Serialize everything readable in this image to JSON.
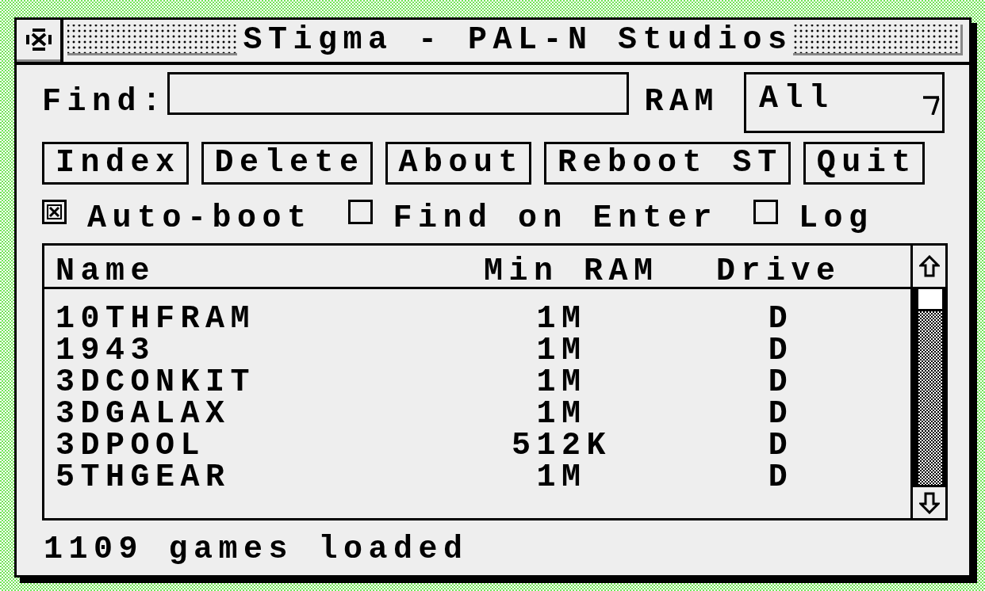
{
  "window": {
    "title": "STigma - PAL-N Studios"
  },
  "search": {
    "label": "Find:"
  },
  "ram_filter": {
    "label": "RAM",
    "value": "All"
  },
  "buttons": [
    "Index",
    "Delete",
    "About",
    "Reboot ST",
    "Quit"
  ],
  "options": [
    {
      "label": "Auto-boot",
      "checked": true
    },
    {
      "label": "Find on Enter",
      "checked": false
    },
    {
      "label": "Log",
      "checked": false
    }
  ],
  "table": {
    "columns": [
      "Name",
      "Min RAM",
      "Drive"
    ],
    "rows": [
      [
        "10THFRAM",
        "1M",
        "D"
      ],
      [
        "1943",
        "1M",
        "D"
      ],
      [
        "3DCONKIT",
        "1M",
        "D"
      ],
      [
        "3DGALAX",
        "1M",
        "D"
      ],
      [
        "3DPOOL",
        "512K",
        "D"
      ],
      [
        "5THGEAR",
        "1M",
        "D"
      ]
    ]
  },
  "status_bar": "1109 games loaded"
}
